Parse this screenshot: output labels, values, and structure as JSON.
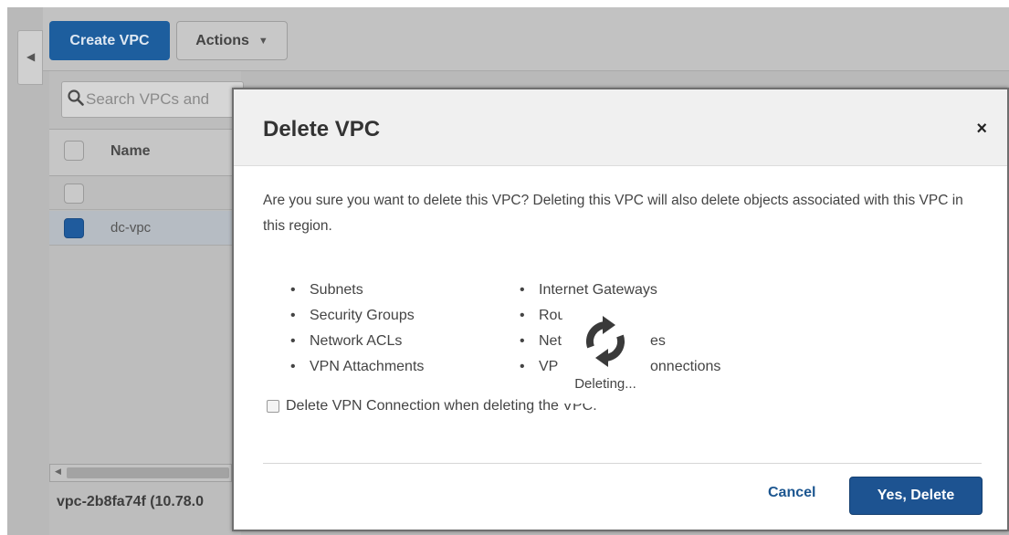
{
  "toolbar": {
    "create_vpc_label": "Create VPC",
    "actions_label": "Actions"
  },
  "search": {
    "placeholder": "Search VPCs and"
  },
  "table": {
    "columns": [
      "Name"
    ],
    "rows": [
      {
        "name": "",
        "selected": false
      },
      {
        "name": "dc-vpc",
        "selected": true
      }
    ]
  },
  "details": {
    "selected_id": "vpc-2b8fa74f (10.78.0"
  },
  "modal": {
    "title": "Delete VPC",
    "close_glyph": "×",
    "message": "Are you sure you want to delete this VPC? Deleting this VPC will also delete objects associated with this VPC in this region.",
    "objects_col1": [
      "Subnets",
      "Security Groups",
      "Network ACLs",
      "VPN Attachments"
    ],
    "objects_col2": [
      "Internet Gateways",
      "Rou",
      "Net",
      "VP"
    ],
    "objects_col3_partial": [
      "es",
      "onnections"
    ],
    "vpn_checkbox_label": "Delete VPN Connection when deleting the VPC.",
    "vpn_checkbox_checked": false,
    "cancel_label": "Cancel",
    "confirm_label": "Yes, Delete"
  },
  "spinner": {
    "label": "Deleting...",
    "icon": "refresh-icon"
  },
  "colors": {
    "primary_button": "#1d5391",
    "link": "#1c5690",
    "overlay_gray": "#b9b9b9"
  }
}
